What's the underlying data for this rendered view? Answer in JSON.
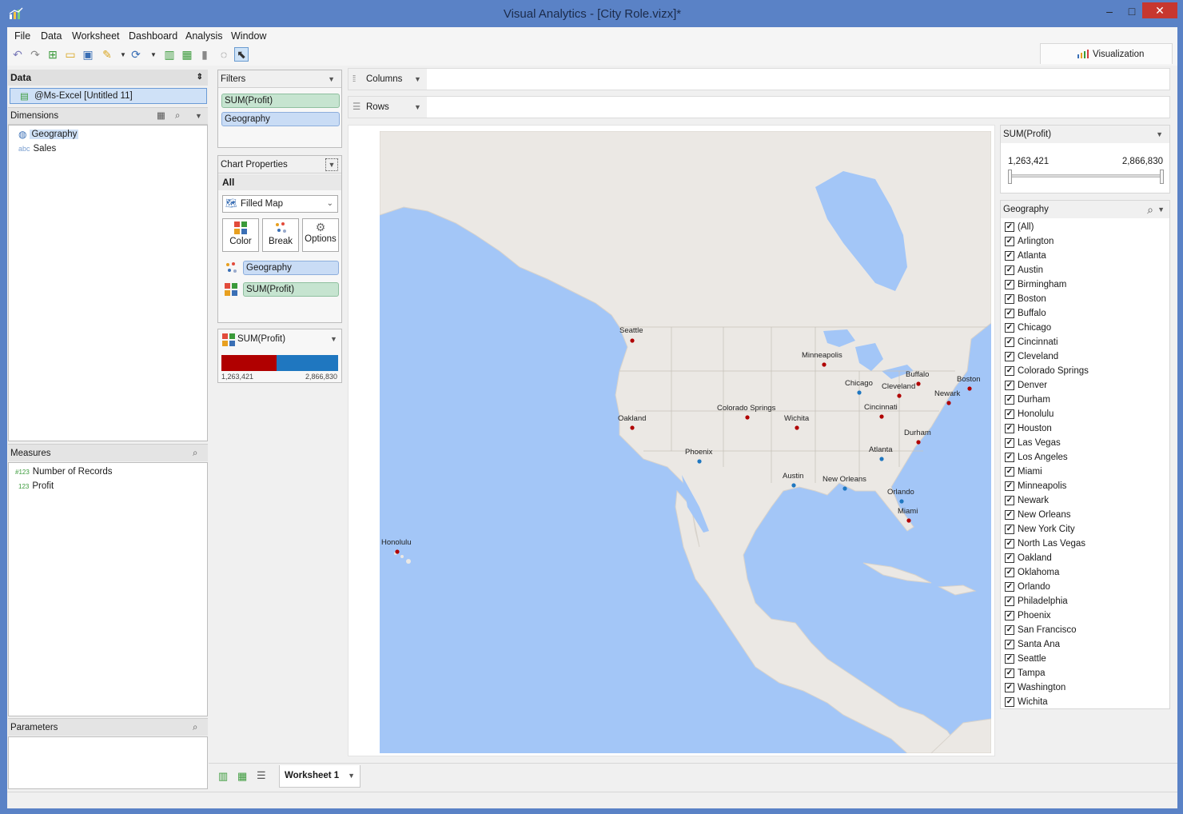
{
  "window": {
    "title": "Visual Analytics - [City Role.vizx]*",
    "min": "–",
    "max": "□",
    "close": "✕"
  },
  "menu": [
    "File",
    "Data",
    "Worksheet",
    "Dashboard",
    "Analysis",
    "Window"
  ],
  "vis_tab": {
    "label": "Visualization"
  },
  "data_panel": {
    "header": "Data",
    "source": "@Ms-Excel [Untitled 11]",
    "dimensions_label": "Dimensions",
    "dimensions": [
      {
        "icon": "globe-icon",
        "label": "Geography"
      },
      {
        "icon": "abc",
        "label": "Sales"
      }
    ],
    "measures_label": "Measures",
    "measures": [
      {
        "icon": "#123",
        "label": "Number of Records"
      },
      {
        "icon": "123",
        "label": "Profit"
      }
    ],
    "parameters_label": "Parameters"
  },
  "filters": {
    "header": "Filters",
    "items": [
      "SUM(Profit)",
      "Geography"
    ]
  },
  "chart_props": {
    "header": "Chart Properties",
    "all_label": "All",
    "chart_type": "Filled Map",
    "buttons": [
      "Color",
      "Break",
      "Options"
    ],
    "marks": [
      "Geography",
      "SUM(Profit)"
    ]
  },
  "legend": {
    "label": "SUM(Profit)",
    "min": "1,263,421",
    "max": "2,866,830",
    "low_color": "#b00000",
    "high_color": "#1f77c0",
    "low_share": 0.47
  },
  "shelves": {
    "columns": "Columns",
    "rows": "Rows"
  },
  "profit_filter": {
    "header": "SUM(Profit)",
    "min": "1,263,421",
    "max": "2,866,830"
  },
  "geo_filter": {
    "header": "Geography",
    "items": [
      "(All)",
      "Arlington",
      "Atlanta",
      "Austin",
      "Birmingham",
      "Boston",
      "Buffalo",
      "Chicago",
      "Cincinnati",
      "Cleveland",
      "Colorado Springs",
      "Denver",
      "Durham",
      "Honolulu",
      "Houston",
      "Las Vegas",
      "Los Angeles",
      "Miami",
      "Minneapolis",
      "Newark",
      "New Orleans",
      "New York City",
      "North Las Vegas",
      "Oakland",
      "Oklahoma",
      "Orlando",
      "Philadelphia",
      "Phoenix",
      "San Francisco",
      "Santa Ana",
      "Seattle",
      "Tampa",
      "Washington",
      "Wichita"
    ]
  },
  "map_cities": [
    {
      "name": "Seattle",
      "color": "red"
    },
    {
      "name": "Minneapolis",
      "color": "red"
    },
    {
      "name": "Buffalo",
      "color": "red"
    },
    {
      "name": "Boston",
      "color": "red"
    },
    {
      "name": "Chicago",
      "color": "blue"
    },
    {
      "name": "Cleveland",
      "color": "red"
    },
    {
      "name": "Newark",
      "color": "red"
    },
    {
      "name": "Cincinnati",
      "color": "red"
    },
    {
      "name": "Oakland",
      "color": "red"
    },
    {
      "name": "Colorado Springs",
      "color": "red"
    },
    {
      "name": "Wichita",
      "color": "red"
    },
    {
      "name": "Durham",
      "color": "red"
    },
    {
      "name": "Phoenix",
      "color": "blue"
    },
    {
      "name": "Atlanta",
      "color": "blue"
    },
    {
      "name": "Austin",
      "color": "blue"
    },
    {
      "name": "New Orleans",
      "color": "blue"
    },
    {
      "name": "Orlando",
      "color": "blue"
    },
    {
      "name": "Miami",
      "color": "red"
    },
    {
      "name": "Honolulu",
      "color": "red"
    }
  ],
  "sheet_tab": {
    "label": "Worksheet 1"
  }
}
